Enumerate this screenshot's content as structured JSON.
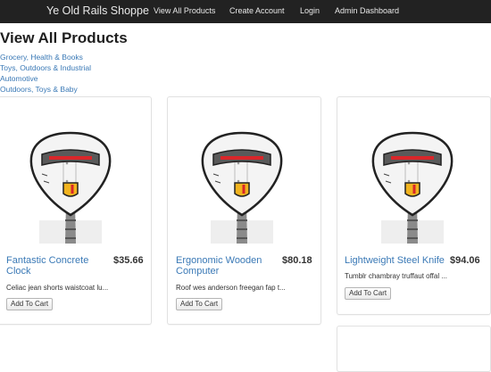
{
  "navbar": {
    "brand": "Ye Old Rails Shoppe",
    "links": [
      "View All Products",
      "Create Account",
      "Login",
      "Admin Dashboard"
    ]
  },
  "page": {
    "title": "View All Products"
  },
  "categories": [
    "Grocery, Health & Books",
    "Toys, Outdoors & Industrial",
    "Automotive",
    "Outdoors, Toys & Baby"
  ],
  "products": [
    {
      "name": "Fantastic Concrete Clock",
      "price": "$35.66",
      "description": "Celiac jean shorts waistcoat lu...",
      "button": "Add To Cart",
      "image": "robot-icon"
    },
    {
      "name": "Ergonomic Wooden Computer",
      "price": "$80.18",
      "description": "Roof wes anderson freegan fap t...",
      "button": "Add To Cart",
      "image": "robot-icon"
    },
    {
      "name": "Lightweight Steel Knife",
      "price": "$94.06",
      "description": "Tumblr chambray truffaut offal ...",
      "button": "Add To Cart",
      "image": "robot-icon"
    }
  ],
  "colors": {
    "navbar": "#222222",
    "link": "#3a79b6",
    "accent_red": "#d9262a",
    "accent_gold": "#f2b41f"
  }
}
